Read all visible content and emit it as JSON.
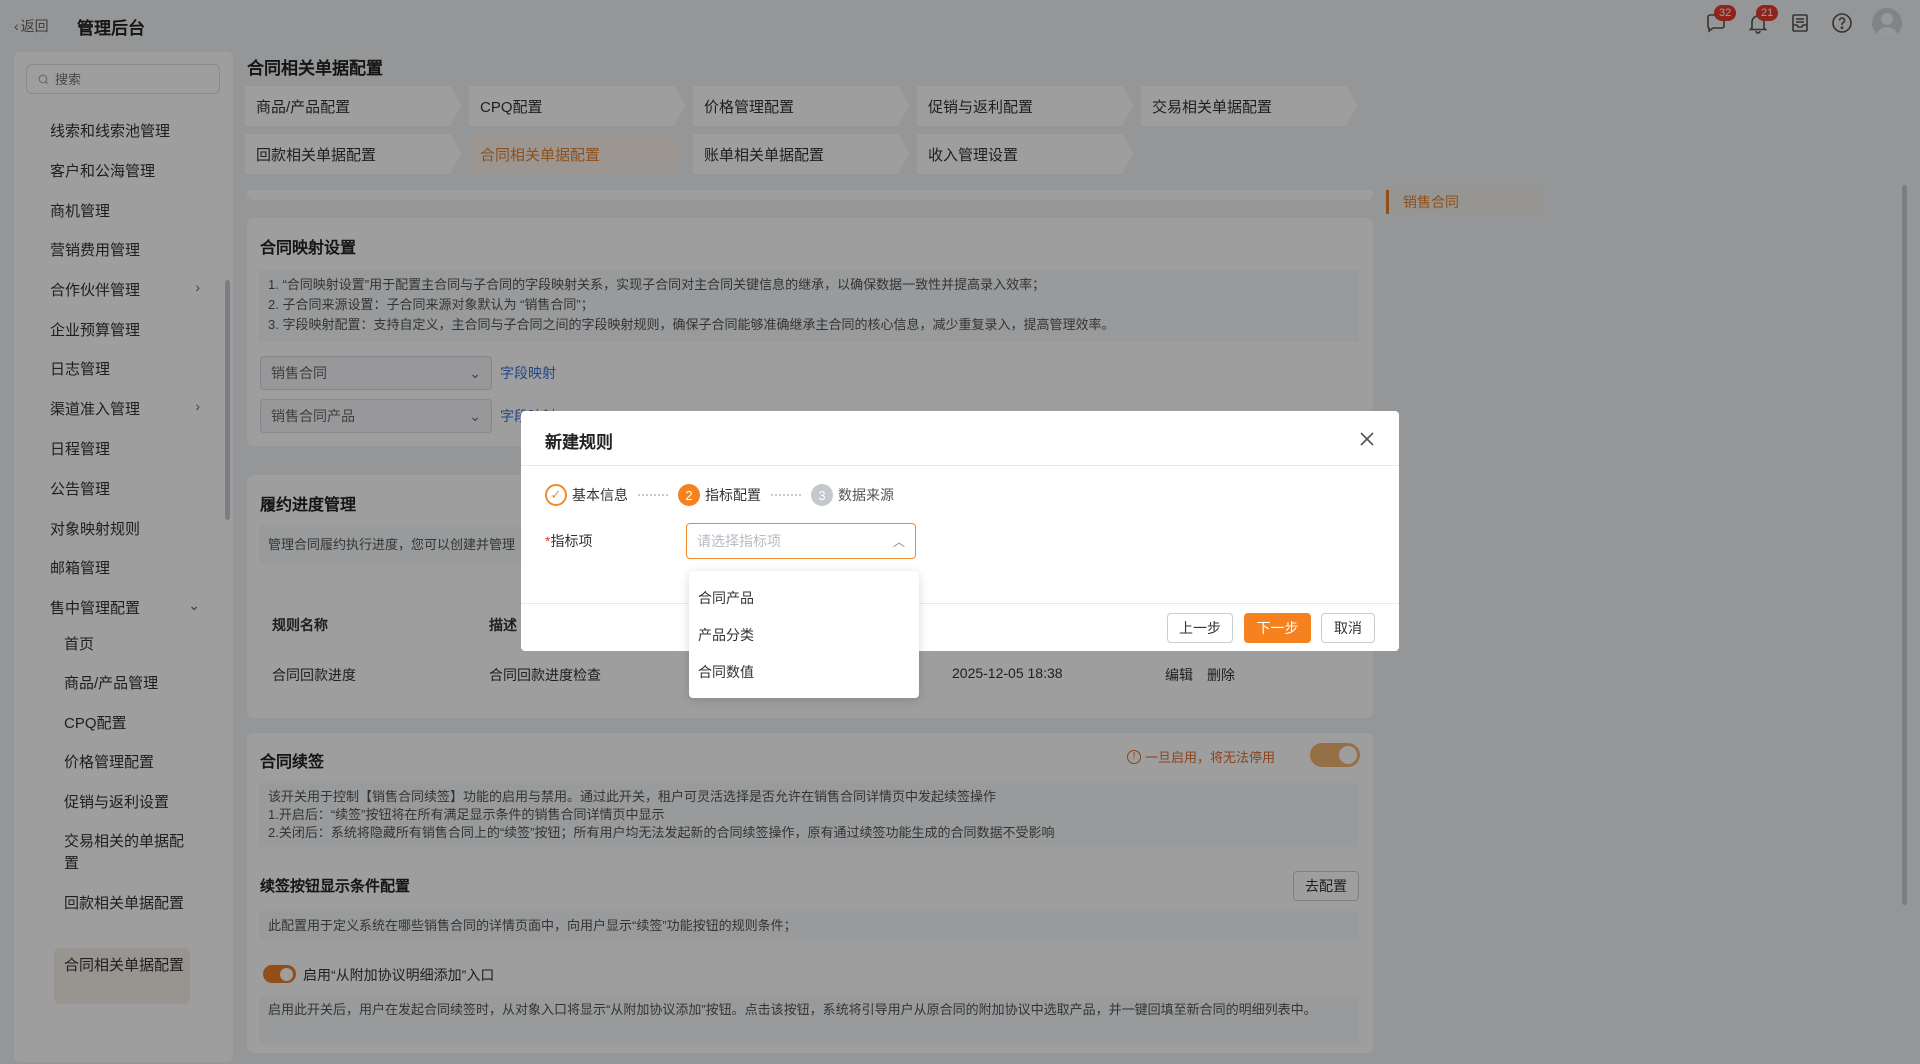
{
  "topbar": {
    "back_label": "返回",
    "app_title": "管理后台",
    "chat_badge": "32",
    "bell_badge": "21"
  },
  "sidebar": {
    "search_placeholder": "搜索",
    "items": [
      "线索和线索池管理",
      "客户和公海管理",
      "商机管理",
      "营销费用管理",
      "合作伙伴管理",
      "企业预算管理",
      "日志管理",
      "渠道准入管理",
      "日程管理",
      "公告管理",
      "对象映射规则",
      "邮箱管理",
      "售中管理配置"
    ],
    "sub_items": [
      "首页",
      "商品/产品管理",
      "CPQ配置",
      "价格管理配置",
      "促销与返利设置",
      "交易相关的单据配置",
      "回款相关单据配置",
      "合同相关单据配置"
    ]
  },
  "main": {
    "title": "合同相关单据配置",
    "tabs": [
      "商品/产品配置",
      "CPQ配置",
      "价格管理配置",
      "促销与返利配置",
      "交易相关单据配置",
      "回款相关单据配置",
      "合同相关单据配置",
      "账单相关单据配置",
      "收入管理设置"
    ],
    "anchor": "销售合同",
    "mapping": {
      "title": "合同映射设置",
      "desc": [
        "1. “合同映射设置”用于配置主合同与子合同的字段映射关系，实现子合同对主合同关键信息的继承，以确保数据一致性并提高录入效率；",
        "2. 子合同来源设置：子合同来源对象默认为 “销售合同”；",
        "3. 字段映射配置：支持自定义，主合同与子合同之间的字段映射规则，确保子合同能够准确继承主合同的核心信息，减少重复录入，提高管理效率。"
      ],
      "select1": "销售合同",
      "select2": "销售合同产品",
      "link1": "字段映射",
      "link2": "字段映射"
    },
    "progress": {
      "title": "履约进度管理",
      "desc": "管理合同履约执行进度，您可以创建并管理",
      "col_name": "规则名称",
      "col_desc": "描述",
      "row": {
        "name": "合同回款进度",
        "desc": "合同回款进度检查",
        "time": "2025-12-05 18:38",
        "edit": "编辑",
        "delete": "删除"
      }
    },
    "renew": {
      "title": "合同续签",
      "warning": "一旦启用，将无法停用",
      "desc": [
        "该开关用于控制【销售合同续签】功能的启用与禁用。通过此开关，租户可灵活选择是否允许在销售合同详情页中发起续签操作",
        "1.开启后：“续签”按钮将在所有满足显示条件的销售合同详情页中显示",
        "2.关闭后：系统将隐藏所有销售合同上的“续签”按钮；所有用户均无法发起新的合同续签操作，原有通过续签功能生成的合同数据不受影响"
      ],
      "cond_title": "续签按钮显示条件配置",
      "cond_button": "去配置",
      "cond_desc": "此配置用于定义系统在哪些销售合同的详情页面中，向用户显示“续签”功能按钮的规则条件；",
      "addon_toggle_label": "启用“从附加协议明细添加”入口",
      "addon_desc": "启用此开关后，用户在发起合同续签时，从对象入口将显示“从附加协议添加”按钮。点击该按钮，系统将引导用户从原合同的附加协议中选取产品，并一键回填至新合同的明细列表中。"
    }
  },
  "modal": {
    "title": "新建规则",
    "steps": [
      {
        "num": "",
        "label": "基本信息",
        "state": "done"
      },
      {
        "num": "2",
        "label": "指标配置",
        "state": "current"
      },
      {
        "num": "3",
        "label": "数据来源",
        "state": "todo"
      }
    ],
    "field_label": "指标项",
    "field_required": "*",
    "placeholder": "请选择指标项",
    "options": [
      "合同产品",
      "产品分类",
      "合同数值"
    ],
    "btn_prev": "上一步",
    "btn_next": "下一步",
    "btn_cancel": "取消"
  }
}
